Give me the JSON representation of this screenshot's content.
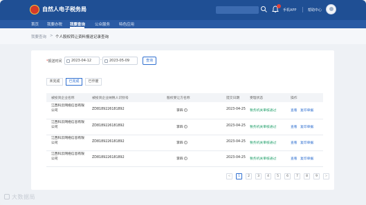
{
  "header": {
    "title": "自然人电子税务局",
    "mobile_app": "手机APP",
    "help_center": "帮助中心"
  },
  "nav": {
    "items": [
      "首页",
      "我要办税",
      "我要查询",
      "公众服务",
      "特色应用"
    ],
    "active_index": 2
  },
  "breadcrumb": {
    "parent": "我要查询",
    "separator": ">",
    "current": "个人股权转让资料报送记录查询"
  },
  "filter": {
    "label": "报送时间",
    "start_date": "2023-04-12",
    "end_date": "2023-05-09",
    "separator": "-",
    "query_label": "查询"
  },
  "tabs": [
    "未完成",
    "已完成",
    "已作废"
  ],
  "active_tab": 1,
  "table": {
    "columns": [
      "被投资企业名称",
      "被投资企业纳税人识别号",
      "股权受让方名称",
      "提交日期",
      "受理状态",
      "操作"
    ],
    "rows": [
      {
        "company_line1": "江西科云网络信息有限",
        "company_line2": "公司",
        "tax_id": "ZD8189226181892",
        "transferee": "李四",
        "date": "2023-04-25",
        "status": "税务机关审核通过",
        "action_view": "查看",
        "action_print": "复印单据"
      },
      {
        "company_line1": "江西科云网络信息有限",
        "company_line2": "公司",
        "tax_id": "ZD8189226181892",
        "transferee": "李四",
        "date": "2023-04-25",
        "status": "税务机关审核通过",
        "action_view": "查看",
        "action_print": "复印单据"
      },
      {
        "company_line1": "江西科云网络信息有限",
        "company_line2": "公司",
        "tax_id": "ZD8189226181892",
        "transferee": "李四",
        "date": "2023-04-25",
        "status": "税务机关审核通过",
        "action_view": "查看",
        "action_print": "复印单据"
      },
      {
        "company_line1": "江西科云网络信息有限",
        "company_line2": "公司",
        "tax_id": "ZD8189226181892",
        "transferee": "李四",
        "date": "2023-04-25",
        "status": "税务机关审核通过",
        "action_view": "查看",
        "action_print": "复印单据"
      }
    ]
  },
  "pagination": {
    "prev": "<",
    "pages": [
      "1",
      "2",
      "3",
      "4",
      "5",
      "6",
      "7",
      "8",
      "9"
    ],
    "next": ">",
    "current_page": 1
  },
  "watermark": "大数据局",
  "colors": {
    "header_bg": "#1f4f94",
    "nav_bg": "#2a5ba4",
    "accent": "#2f6fd0",
    "status_green": "#22a06b"
  }
}
